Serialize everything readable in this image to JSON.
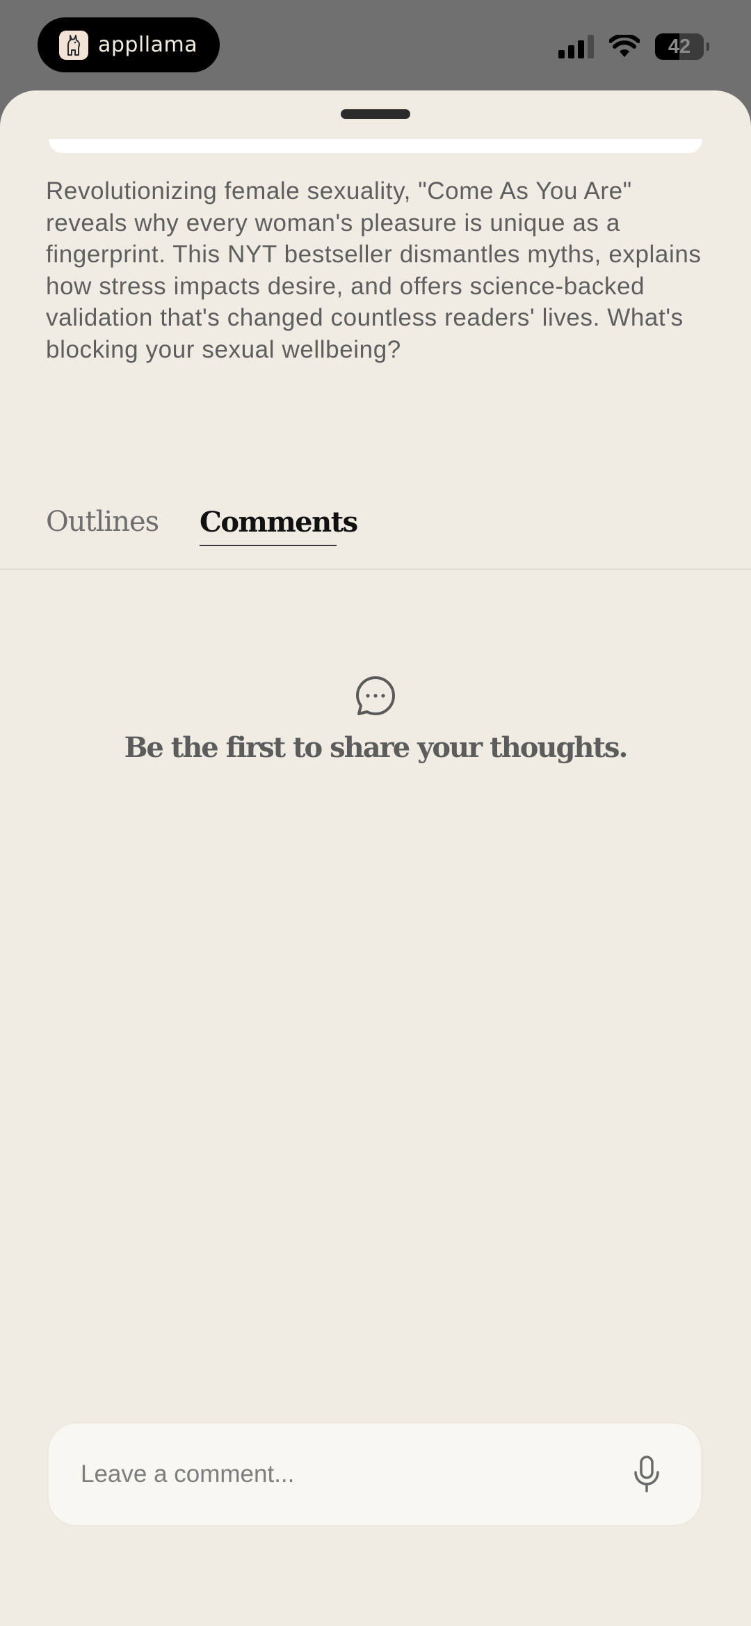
{
  "status_bar": {
    "app_name": "appllama",
    "battery_level": "42",
    "signal_bars_active": 3,
    "signal_bars_total": 4
  },
  "book": {
    "description": "Revolutionizing female sexuality, \"Come As You Are\" reveals why every woman's pleasure is unique as a fingerprint. This NYT bestseller dismantles myths, explains how stress impacts desire, and offers science-backed validation that's changed countless readers' lives. What's blocking your sexual wellbeing?"
  },
  "tabs": [
    {
      "label": "Outlines",
      "active": false
    },
    {
      "label": "Comments",
      "active": true
    }
  ],
  "comments": {
    "empty_message": "Be the first to share your thoughts.",
    "empty_icon": "chat-bubble-icon"
  },
  "composer": {
    "placeholder": "Leave a comment...",
    "mic_icon": "microphone-icon"
  },
  "colors": {
    "sheet_background": "#f0ece4",
    "overlay": "#707070",
    "text_primary": "#111111",
    "text_secondary": "#5e5e5e"
  }
}
